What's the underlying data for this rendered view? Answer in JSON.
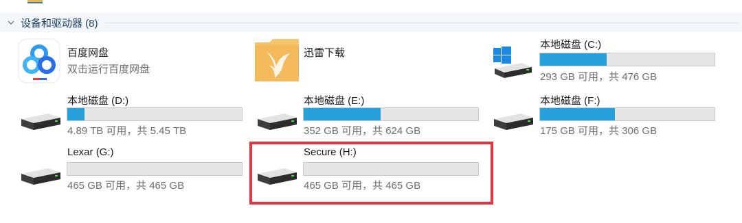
{
  "group": {
    "title": "设备和驱动器 (8)"
  },
  "apps": [
    {
      "name": "百度网盘",
      "subtitle": "双击运行百度网盘",
      "icon": "baidu-netdisk-icon"
    },
    {
      "name": "迅雷下载",
      "icon": "thunder-download-folder-icon"
    }
  ],
  "drives": [
    {
      "name": "本地磁盘 (C:)",
      "free_text": "293 GB 可用，共 476 GB",
      "used_fraction": 0.38,
      "icon": "windows-drive-icon"
    },
    {
      "name": "本地磁盘 (D:)",
      "free_text": "4.89 TB 可用，共 5.45 TB",
      "used_fraction": 0.1,
      "icon": "hard-drive-icon"
    },
    {
      "name": "本地磁盘 (E:)",
      "free_text": "352 GB 可用，共 624 GB",
      "used_fraction": 0.44,
      "icon": "hard-drive-icon"
    },
    {
      "name": "本地磁盘 (F:)",
      "free_text": "175 GB 可用，共 306 GB",
      "used_fraction": 0.43,
      "icon": "hard-drive-icon"
    },
    {
      "name": "Lexar (G:)",
      "free_text": "465 GB 可用，共 465 GB",
      "used_fraction": 0.0,
      "icon": "hard-drive-icon"
    },
    {
      "name": "Secure (H:)",
      "free_text": "465 GB 可用，共 465 GB",
      "used_fraction": 0.0,
      "icon": "hard-drive-icon"
    }
  ],
  "colors": {
    "bar_fill": "#26a0da",
    "highlight": "#e5343d"
  }
}
